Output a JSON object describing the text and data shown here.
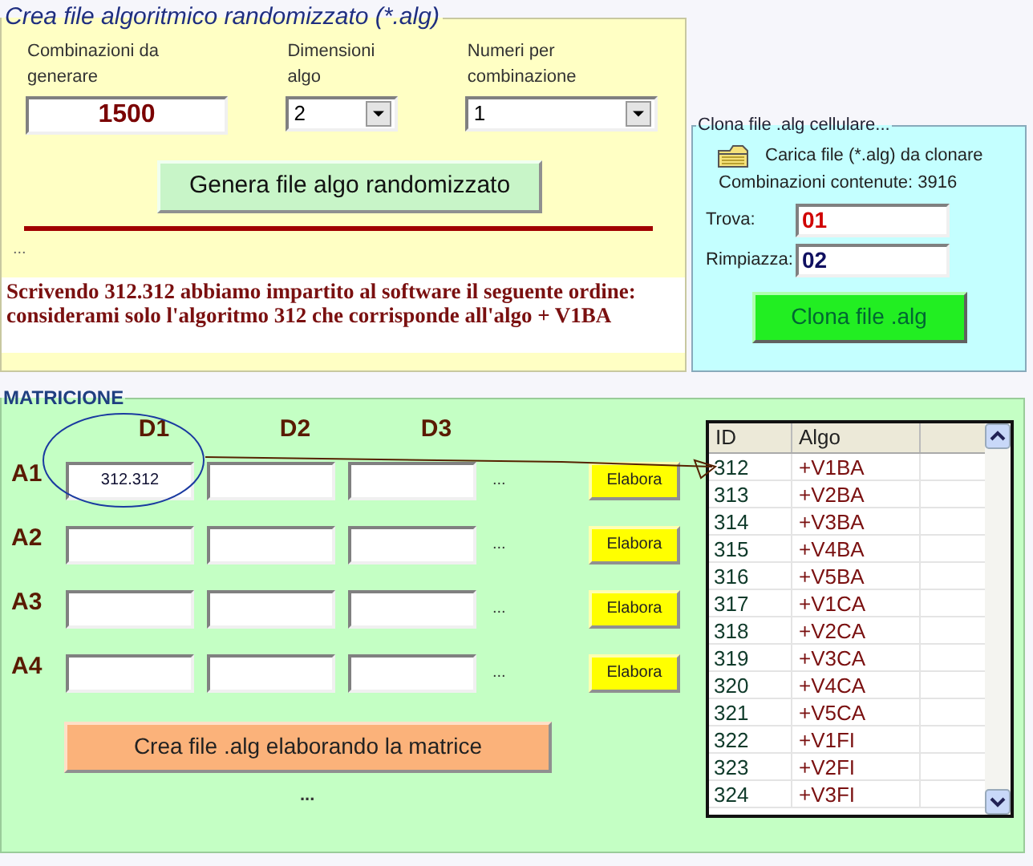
{
  "generator": {
    "title": "Crea file algoritmico randomizzato (*.alg)",
    "fields": [
      {
        "label": "Combinazioni da generare",
        "value": "1500",
        "kind": "text"
      },
      {
        "label": "Dimensioni algo",
        "value": "2",
        "kind": "select"
      },
      {
        "label": "Numeri per combinazione",
        "value": "1",
        "kind": "select"
      }
    ],
    "button": "Genera file algo randomizzato",
    "status": "...",
    "note": "Scrivendo 312.312 abbiamo impartito al software il seguente ordine: considerami solo l'algoritmo 312 che corrisponde all'algo + V1BA"
  },
  "clone": {
    "title": "Clona file .alg cellulare...",
    "load": "Carica file (*.alg) da clonare",
    "count": "Combinazioni contenute: 3916",
    "find": {
      "label": "Trova:",
      "value": "01"
    },
    "replace": {
      "label": "Rimpiazza:",
      "value": "02"
    },
    "button": "Clona file .alg"
  },
  "matrix": {
    "title": "MATRICIONE",
    "columns": [
      "D1",
      "D2",
      "D3"
    ],
    "rows": [
      {
        "label": "A1",
        "values": [
          "312.312"
        ],
        "more": "...",
        "button": "Elabora"
      },
      {
        "label": "A2",
        "more": "...",
        "button": "Elabora"
      },
      {
        "label": "A3",
        "more": "...",
        "button": "Elabora"
      },
      {
        "label": "A4",
        "more": "...",
        "button": "Elabora"
      }
    ],
    "button": "Crea file .alg elaborando la matrice",
    "status": "..."
  },
  "table": {
    "columns": [
      "ID",
      "Algo"
    ],
    "rows": [
      [
        "312",
        "+V1BA"
      ],
      [
        "313",
        "+V2BA"
      ],
      [
        "314",
        "+V3BA"
      ],
      [
        "315",
        "+V4BA"
      ],
      [
        "316",
        "+V5BA"
      ],
      [
        "317",
        "+V1CA"
      ],
      [
        "318",
        "+V2CA"
      ],
      [
        "319",
        "+V3CA"
      ],
      [
        "320",
        "+V4CA"
      ],
      [
        "321",
        "+V5CA"
      ],
      [
        "322",
        "+V1FI"
      ],
      [
        "323",
        "+V2FI"
      ],
      [
        "324",
        "+V3FI"
      ]
    ]
  }
}
